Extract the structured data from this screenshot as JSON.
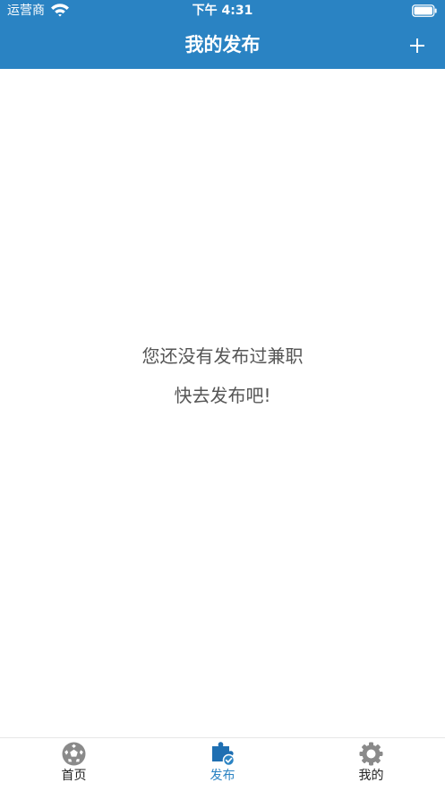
{
  "status_bar": {
    "carrier": "运营商",
    "time": "下午 4:31"
  },
  "header": {
    "title": "我的发布",
    "add_icon": "plus-icon"
  },
  "empty_state": {
    "line1": "您还没有发布过兼职",
    "line2": "快去发布吧!"
  },
  "tab_bar": {
    "active_index": 1,
    "tabs": [
      {
        "label": "首页",
        "icon": "soccer-ball-icon"
      },
      {
        "label": "发布",
        "icon": "puzzle-check-icon"
      },
      {
        "label": "我的",
        "icon": "gear-icon"
      }
    ]
  },
  "colors": {
    "accent": "#2a83c3",
    "inactive_icon": "#8a8a8a",
    "empty_text": "#555555"
  }
}
